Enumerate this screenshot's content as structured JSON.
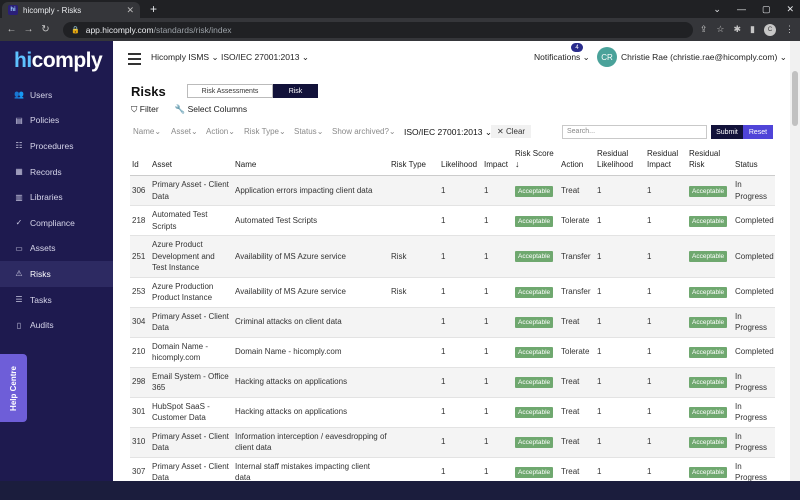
{
  "browser": {
    "tab_title": "hicomply - Risks",
    "tab_icon": "hi",
    "url_host": "app.hicomply.com",
    "url_path": "/standards/risk/index",
    "profile_initial": "C"
  },
  "sidebar": {
    "logo_hi": "hi",
    "logo_rest": "comply",
    "items": [
      {
        "label": "Users",
        "icon": "users-icon",
        "glyph": "👥"
      },
      {
        "label": "Policies",
        "icon": "document-icon",
        "glyph": "▤"
      },
      {
        "label": "Procedures",
        "icon": "list-icon",
        "glyph": "☷"
      },
      {
        "label": "Records",
        "icon": "records-icon",
        "glyph": "▦"
      },
      {
        "label": "Libraries",
        "icon": "library-icon",
        "glyph": "▥"
      },
      {
        "label": "Compliance",
        "icon": "check-icon",
        "glyph": "✓"
      },
      {
        "label": "Assets",
        "icon": "monitor-icon",
        "glyph": "▭"
      },
      {
        "label": "Risks",
        "icon": "warning-icon",
        "glyph": "⚠"
      },
      {
        "label": "Tasks",
        "icon": "tasks-icon",
        "glyph": "☰"
      },
      {
        "label": "Audits",
        "icon": "clipboard-icon",
        "glyph": "▯"
      }
    ],
    "active_index": 7,
    "help_label": "Help Centre"
  },
  "header": {
    "org_select": "Hicomply ISMS",
    "standard_select": "ISO/IEC 27001:2013",
    "notifications_label": "Notifications",
    "notifications_count": "4",
    "avatar_initials": "CR",
    "user_label": "Christie Rae (christie.rae@hicomply.com)"
  },
  "page": {
    "title": "Risks",
    "tabs": [
      "Risk Assessments",
      "Risk"
    ],
    "filter_label": "Filter",
    "select_columns_label": "Select Columns"
  },
  "filters": {
    "name": "Name",
    "asset": "Asset",
    "action": "Action",
    "risk_type": "Risk Type",
    "status": "Status",
    "show_archived": "Show archived?",
    "standard": "ISO/IEC 27001:2013",
    "clear": "Clear",
    "search_placeholder": "Search...",
    "submit": "Submit",
    "reset": "Reset"
  },
  "table": {
    "columns": [
      "Id",
      "Asset",
      "Name",
      "Risk Type",
      "Likelihood",
      "Impact",
      "Risk Score",
      "Action",
      "Residual Likelihood",
      "Residual Impact",
      "Residual Risk",
      "Status"
    ],
    "rows": [
      {
        "id": "306",
        "asset": "Primary Asset - Client Data",
        "name": "Application errors impacting client data",
        "risk_type": "",
        "likelihood": "1",
        "impact": "1",
        "score": "Acceptable",
        "action": "Treat",
        "r_likelihood": "1",
        "r_impact": "1",
        "r_risk": "Acceptable",
        "status": "In Progress"
      },
      {
        "id": "218",
        "asset": "Automated Test Scripts",
        "name": "Automated Test Scripts",
        "risk_type": "",
        "likelihood": "1",
        "impact": "1",
        "score": "Acceptable",
        "action": "Tolerate",
        "r_likelihood": "1",
        "r_impact": "1",
        "r_risk": "Acceptable",
        "status": "Completed"
      },
      {
        "id": "251",
        "asset": "Azure Product Development and Test Instance",
        "name": "Availability of MS Azure service",
        "risk_type": "Risk",
        "likelihood": "1",
        "impact": "1",
        "score": "Acceptable",
        "action": "Transfer",
        "r_likelihood": "1",
        "r_impact": "1",
        "r_risk": "Acceptable",
        "status": "Completed"
      },
      {
        "id": "253",
        "asset": "Azure Production Product Instance",
        "name": "Availability of MS Azure service",
        "risk_type": "Risk",
        "likelihood": "1",
        "impact": "1",
        "score": "Acceptable",
        "action": "Transfer",
        "r_likelihood": "1",
        "r_impact": "1",
        "r_risk": "Acceptable",
        "status": "Completed"
      },
      {
        "id": "304",
        "asset": "Primary Asset - Client Data",
        "name": "Criminal attacks on client data",
        "risk_type": "",
        "likelihood": "1",
        "impact": "1",
        "score": "Acceptable",
        "action": "Treat",
        "r_likelihood": "1",
        "r_impact": "1",
        "r_risk": "Acceptable",
        "status": "In Progress"
      },
      {
        "id": "210",
        "asset": "Domain Name - hicomply.com",
        "name": "Domain Name - hicomply.com",
        "risk_type": "",
        "likelihood": "1",
        "impact": "1",
        "score": "Acceptable",
        "action": "Tolerate",
        "r_likelihood": "1",
        "r_impact": "1",
        "r_risk": "Acceptable",
        "status": "Completed"
      },
      {
        "id": "298",
        "asset": "Email System - Office 365",
        "name": "Hacking attacks on applications",
        "risk_type": "",
        "likelihood": "1",
        "impact": "1",
        "score": "Acceptable",
        "action": "Treat",
        "r_likelihood": "1",
        "r_impact": "1",
        "r_risk": "Acceptable",
        "status": "In Progress"
      },
      {
        "id": "301",
        "asset": "HubSpot SaaS - Customer Data",
        "name": "Hacking attacks on applications",
        "risk_type": "",
        "likelihood": "1",
        "impact": "1",
        "score": "Acceptable",
        "action": "Treat",
        "r_likelihood": "1",
        "r_impact": "1",
        "r_risk": "Acceptable",
        "status": "In Progress"
      },
      {
        "id": "310",
        "asset": "Primary Asset - Client Data",
        "name": "Information interception / eavesdropping of client data",
        "risk_type": "",
        "likelihood": "1",
        "impact": "1",
        "score": "Acceptable",
        "action": "Treat",
        "r_likelihood": "1",
        "r_impact": "1",
        "r_risk": "Acceptable",
        "status": "In Progress"
      },
      {
        "id": "307",
        "asset": "Primary Asset - Client Data",
        "name": "Internal staff mistakes impacting client data",
        "risk_type": "",
        "likelihood": "1",
        "impact": "1",
        "score": "Acceptable",
        "action": "Treat",
        "r_likelihood": "1",
        "r_impact": "1",
        "r_risk": "Acceptable",
        "status": "In Progress"
      }
    ]
  }
}
